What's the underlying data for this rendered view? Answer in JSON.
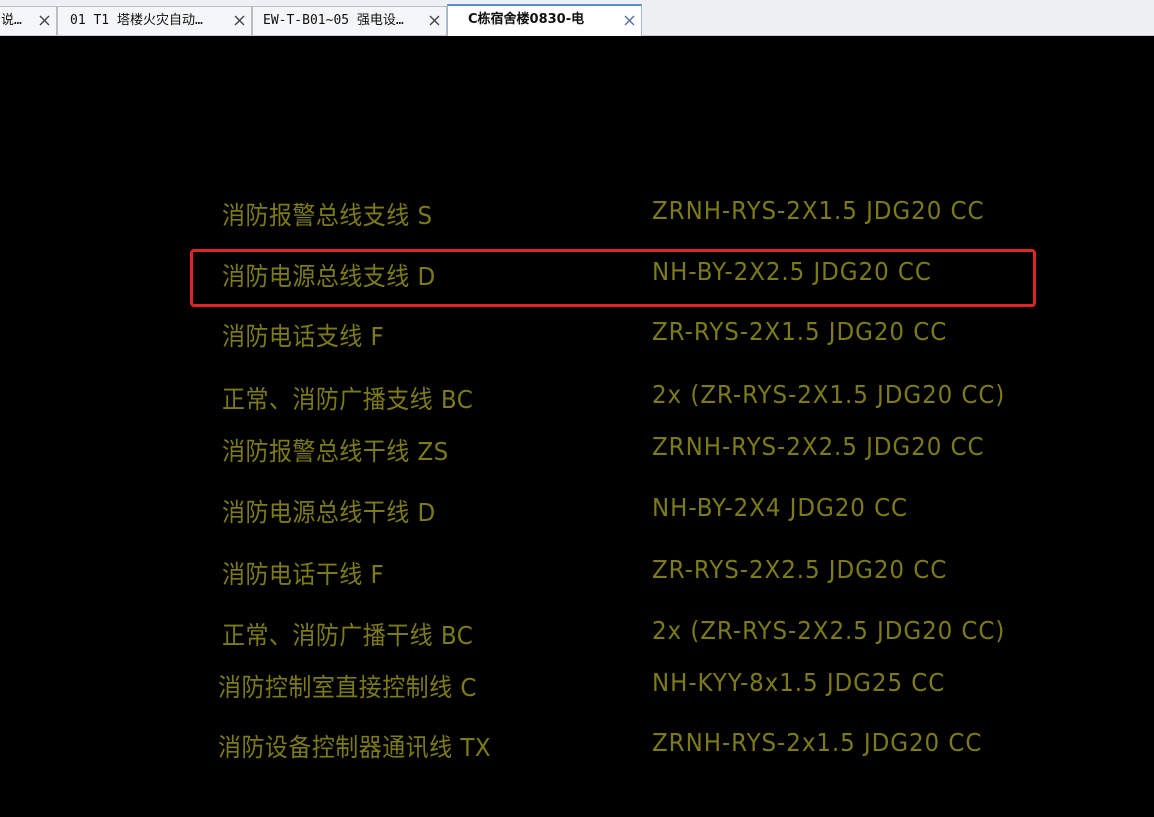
{
  "tabs": [
    {
      "label": "说…",
      "active": false
    },
    {
      "label": "01 T1 塔楼火灾自动…",
      "active": false
    },
    {
      "label": "EW-T-B01~05 强电设…",
      "active": false
    },
    {
      "label": "C栋宿舍楼0830-电",
      "active": true
    }
  ],
  "legend_rows": [
    {
      "label": "消防报警总线支线  S",
      "spec": "ZRNH-RYS-2X1.5 JDG20 CC"
    },
    {
      "label": "消防电源总线支线  D",
      "spec": "NH-BY-2X2.5 JDG20 CC"
    },
    {
      "label": "消防电话支线  F",
      "spec": "ZR-RYS-2X1.5 JDG20 CC"
    },
    {
      "label": "正常、消防广播支线  BC",
      "spec": "2x (ZR-RYS-2X1.5 JDG20 CC)"
    },
    {
      "label": "消防报警总线干线  ZS",
      "spec": "ZRNH-RYS-2X2.5 JDG20 CC"
    },
    {
      "label": "消防电源总线干线  D",
      "spec": "NH-BY-2X4 JDG20 CC"
    },
    {
      "label": "消防电话干线  F",
      "spec": "ZR-RYS-2X2.5 JDG20 CC"
    },
    {
      "label": "正常、消防广播干线  BC",
      "spec": "2x (ZR-RYS-2X2.5 JDG20 CC)"
    },
    {
      "label": "消防控制室直接控制线  C",
      "spec": "NH-KYY-8x1.5 JDG25 CC"
    },
    {
      "label": "消防设备控制器通讯线  TX",
      "spec": "ZRNH-RYS-2x1.5 JDG20 CC"
    }
  ],
  "colors": {
    "canvas_background": "#000000",
    "text": "#7d7a19",
    "highlight": "#e02424"
  },
  "icons": {
    "tab_close": "close-icon"
  }
}
